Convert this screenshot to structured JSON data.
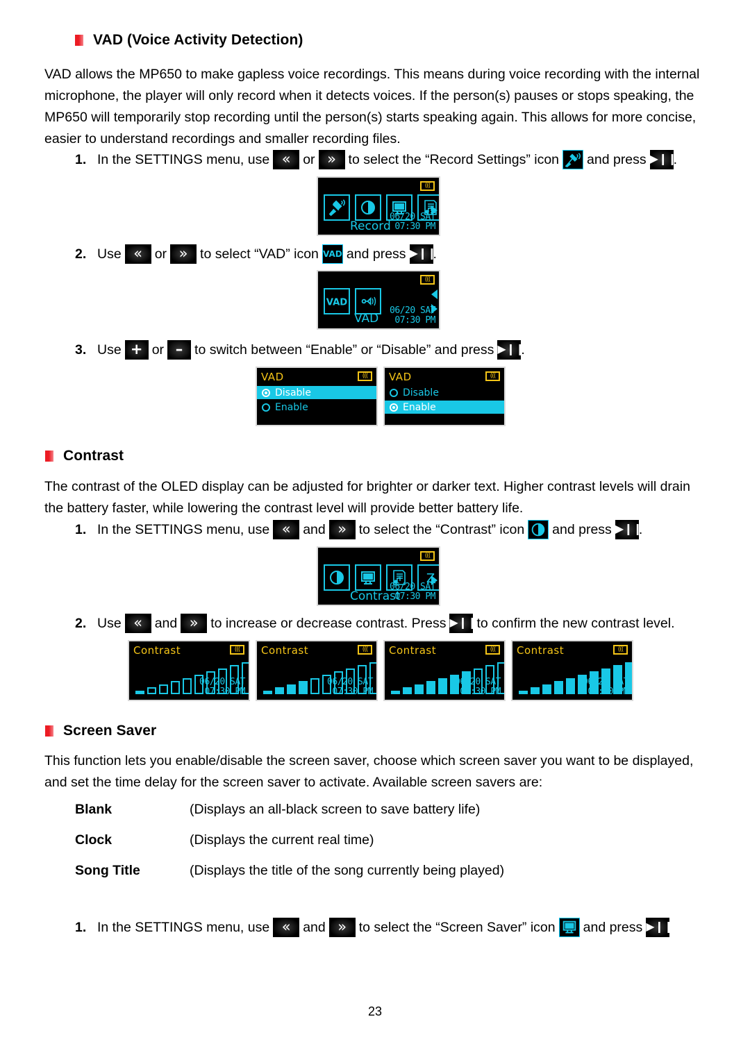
{
  "sections": {
    "vad": {
      "heading": "VAD (Voice Activity Detection)",
      "paragraph": "VAD allows the MP650 to make gapless voice recordings. This means during voice recording with the internal microphone, the player will only record when it detects voices. If the person(s) pauses or stops speaking, the MP650 will temporarily stop recording until the person(s) starts speaking again. This allows for more concise, easier to understand recordings and smaller recording files.",
      "steps": [
        {
          "num": "1.",
          "t1": "In the SETTINGS menu, use",
          "t2": "or",
          "t3": "to select the “Record Settings” icon",
          "t4": "and press",
          "t5": "."
        },
        {
          "num": "2.",
          "t1": "Use",
          "t2": "or",
          "t3": "to select “VAD” icon",
          "t4": "and press",
          "t5": "."
        },
        {
          "num": "3.",
          "t1": "Use",
          "t2": "or",
          "t3": "to switch between “Enable” or “Disable” and press",
          "t4": "."
        }
      ]
    },
    "contrast": {
      "heading": "Contrast",
      "paragraph": "The contrast of the OLED display can be adjusted for brighter or darker text.  Higher contrast levels will drain the battery faster, while lowering the contrast level will provide better battery life.",
      "steps": [
        {
          "num": "1.",
          "t1": "In the SETTINGS menu, use",
          "t2": "and",
          "t3": "to select the “Contrast” icon",
          "t4": "and press",
          "t5": "."
        },
        {
          "num": "2.",
          "t1": "Use",
          "t2": "and",
          "t3": "to increase or decrease contrast. Press",
          "t4": "to confirm the new contrast level."
        }
      ]
    },
    "screensaver": {
      "heading": "Screen Saver",
      "paragraph": "This function lets you enable/disable the screen saver, choose which screen saver you want to be displayed, and set the time delay for the screen saver to activate.    Available screen savers are:",
      "options": [
        {
          "term": "Blank",
          "desc": "(Displays an all-black screen to save battery life)"
        },
        {
          "term": "Clock",
          "desc": "(Displays the current real time)"
        },
        {
          "term": "Song Title",
          "desc": "(Displays the title of the song currently being played)"
        }
      ],
      "steps": [
        {
          "num": "1.",
          "t1": "In the SETTINGS menu, use",
          "t2": "and",
          "t3": "to select the “Screen Saver” icon",
          "t4": "and press"
        }
      ]
    }
  },
  "screens": {
    "record_settings": {
      "label": "Record Settings",
      "date": "06/20 SAT",
      "time": "07:30 PM",
      "battery": "((("
    },
    "vad_menu": {
      "label": "VAD",
      "date": "06/20 SAT",
      "time": "07:30 PM",
      "battery": "((("
    },
    "vad_disable": {
      "title": "VAD",
      "battery": "(((",
      "options": [
        {
          "label": "Disable",
          "selected": true,
          "checked": true
        },
        {
          "label": "Enable",
          "selected": false,
          "checked": false
        }
      ]
    },
    "vad_enable": {
      "title": "VAD",
      "battery": "(((",
      "options": [
        {
          "label": "Disable",
          "selected": false,
          "checked": false
        },
        {
          "label": "Enable",
          "selected": true,
          "checked": true
        }
      ]
    },
    "contrast_menu": {
      "label": "Contrast",
      "date": "06/20 SAT",
      "time": "07:30 PM",
      "battery": "((("
    },
    "contrast_levels": [
      {
        "title": "Contrast",
        "battery": "(((",
        "date": "06/20 SAT",
        "time": "07:30 PM",
        "filled": 1
      },
      {
        "title": "Contrast",
        "battery": "(((",
        "date": "06/20 SAT",
        "time": "07:30 PM",
        "filled": 4
      },
      {
        "title": "Contrast",
        "battery": "(((",
        "date": "06/20 SAT",
        "time": "07:30 PM",
        "filled": 7
      },
      {
        "title": "Contrast",
        "battery": "(((",
        "date": "06/20 SAT",
        "time": "07:30 PM",
        "filled": 10
      }
    ],
    "bar_count": 10
  },
  "icons": {
    "prev": "«",
    "next": "»",
    "play_pause": "▶❙❙",
    "plus": "+",
    "minus": "–",
    "vad_chip": "VAD"
  },
  "footer": {
    "page_number": "23"
  }
}
